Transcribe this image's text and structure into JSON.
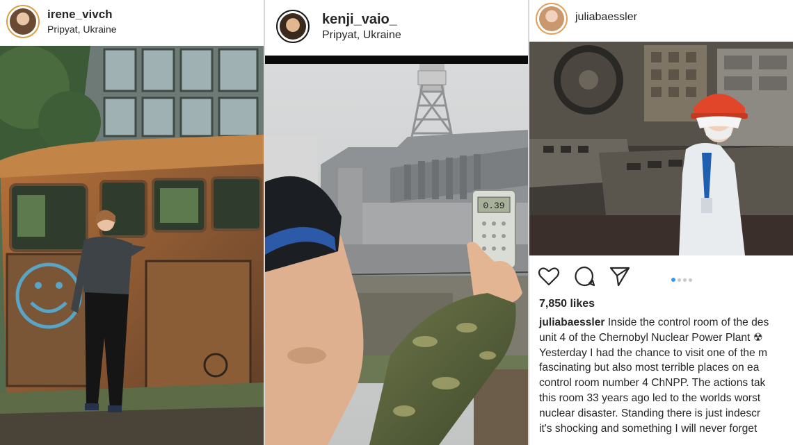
{
  "posts": [
    {
      "username": "irene_vivch",
      "location": "Pripyat, Ukraine"
    },
    {
      "username": "kenji_vaio_",
      "location": "Pripyat, Ukraine"
    },
    {
      "username": "juliabaessler",
      "likes": "7,850 likes",
      "caption_user": "juliabaessler",
      "caption_lines": [
        "Inside the control room of the des",
        "unit 4 of the Chernobyl Nuclear Power Plant ☢",
        "Yesterday I had the chance to visit one of the m",
        "fascinating but also most terrible places on ea",
        "control room number 4 ChNPP. The actions tak",
        "this room 33 years ago led to the worlds worst",
        "nuclear disaster. Standing there is just indescr",
        "it's shocking and something I will never forget"
      ],
      "carousel_active_index": 0,
      "carousel_count": 4
    }
  ],
  "icons": {
    "like": "heart-icon",
    "comment": "comment-icon",
    "share": "send-icon"
  }
}
